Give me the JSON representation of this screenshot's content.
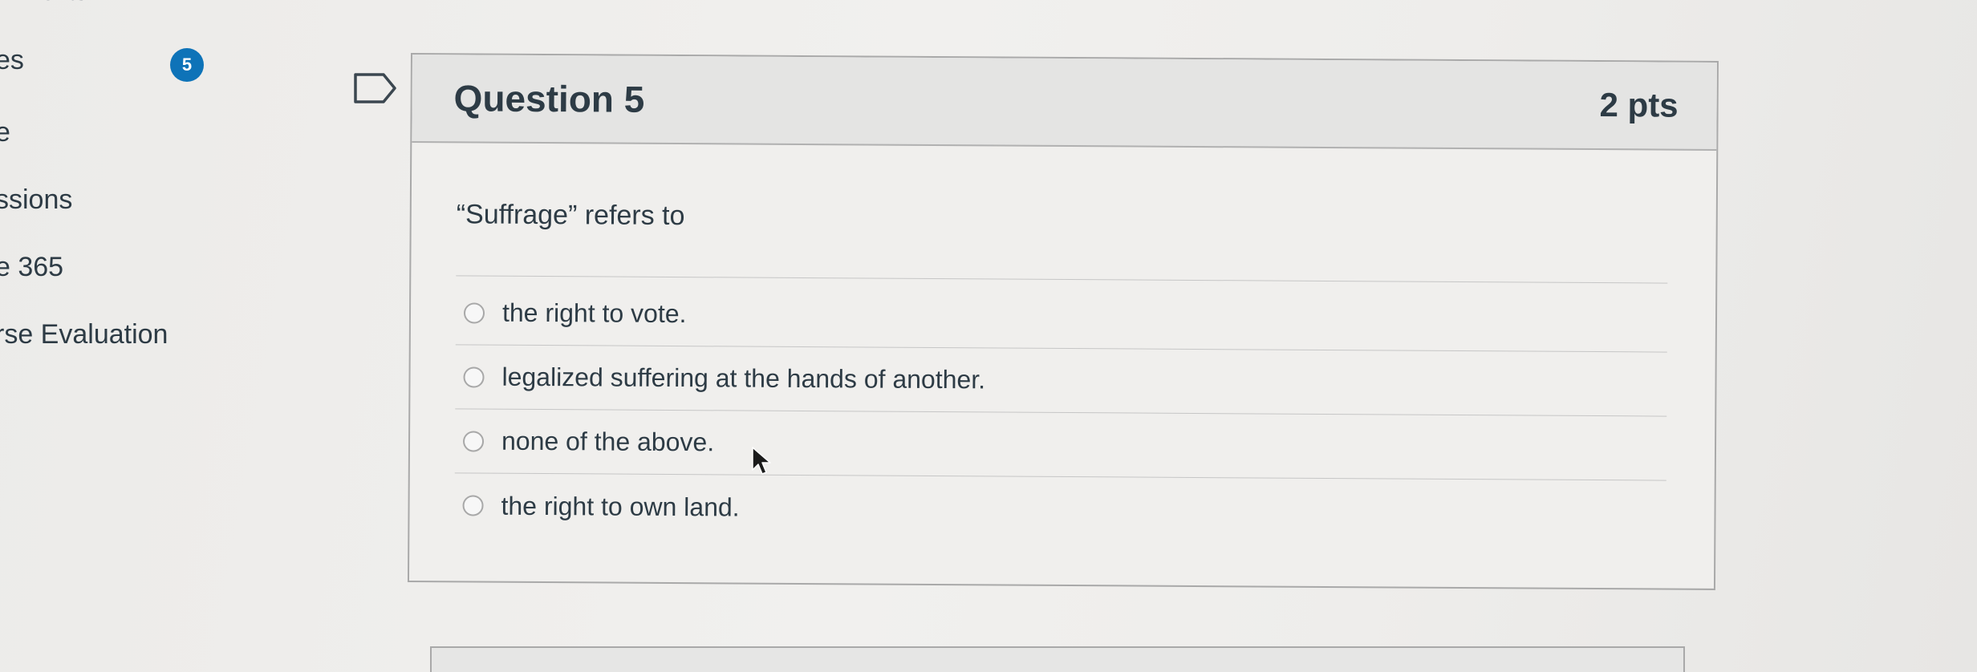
{
  "nav": {
    "top_partial": "nments",
    "badge_count": "5",
    "items": [
      "es",
      "e",
      "ssions",
      "e 365",
      "rse Evaluation"
    ]
  },
  "question": {
    "title": "Question 5",
    "points": "2 pts",
    "text": "“Suffrage” refers to",
    "answers": [
      "the right to vote.",
      "legalized suffering at the hands of another.",
      "none of the above.",
      "the right to own land."
    ]
  },
  "icons": [
    "flag-icon",
    "radio-icon",
    "cursor-icon"
  ],
  "colors": {
    "badge": "#0e73b8",
    "text": "#2d3b45",
    "header_bg": "#e4e4e3"
  }
}
